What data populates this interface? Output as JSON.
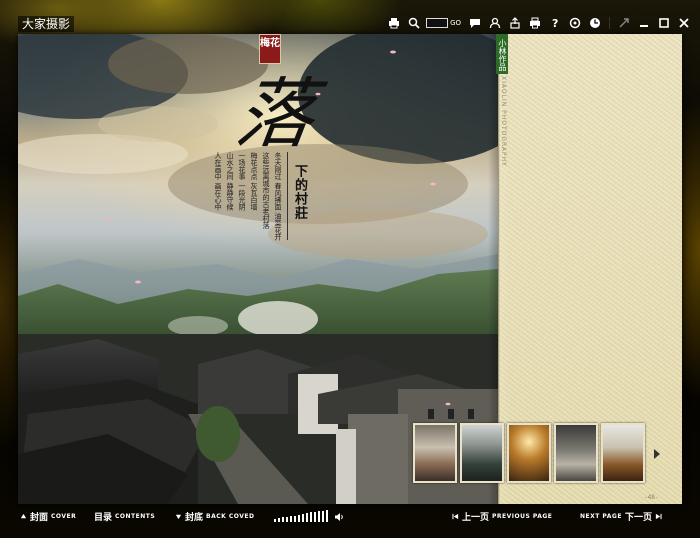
{
  "app": {
    "title": "大家摄影"
  },
  "toolbar": {
    "items": [
      {
        "name": "print-icon"
      },
      {
        "name": "zoom-icon"
      },
      {
        "name": "comment-icon"
      },
      {
        "name": "user-icon"
      },
      {
        "name": "share-icon"
      },
      {
        "name": "printer-icon"
      },
      {
        "name": "help-icon"
      },
      {
        "name": "settings-icon"
      },
      {
        "name": "clock-icon"
      },
      {
        "name": "fullscreen-icon"
      },
      {
        "name": "minimize-icon"
      },
      {
        "name": "maximize-icon"
      },
      {
        "name": "close-icon"
      }
    ],
    "page_input": "",
    "go_label": "GO"
  },
  "page_left": {
    "badge": "梅花",
    "title_char": "落",
    "subtitle": "下的村莊",
    "poem_lines": [
      "冬天刚过 春风拂面 油菜花开",
      "这些远离城市的古老村落",
      "梅花点点 灰瓦白墙",
      "一场花事 一段光阴",
      "山水之间 静静守候",
      "人在画中 画在心中"
    ]
  },
  "page_right": {
    "badge": "小林作品",
    "vertical_text": "XIAOLIN PHOTOGRAPHY",
    "page_number": "-48-"
  },
  "bottom": {
    "cover": {
      "cn": "封面",
      "en": "COVER"
    },
    "contents": {
      "cn": "目录",
      "en": "CONTENTS"
    },
    "back_cover": {
      "cn": "封底",
      "en": "BACK COVED"
    },
    "prev": {
      "cn": "上一页",
      "en": "PREVIOUS PAGE"
    },
    "next": {
      "en": "NEXT PAGE",
      "cn": "下一页"
    }
  },
  "colors": {
    "accent_red": "#8b1a1a",
    "accent_green": "#2f6b28",
    "paper": "#efe6bf"
  }
}
